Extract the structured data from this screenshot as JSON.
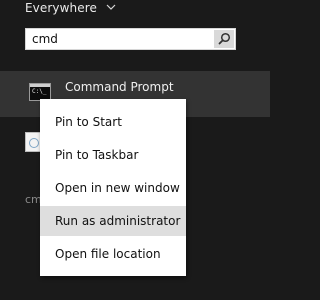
{
  "search_scope": {
    "label": "Everywhere",
    "icon": "chevron-down-icon"
  },
  "search": {
    "value": "cmd",
    "button_icon": "search-icon"
  },
  "results": [
    {
      "title": "Command Prompt",
      "icon": "command-prompt-icon",
      "selected": true
    },
    {
      "icon": "app-icon"
    }
  ],
  "faded_text": "cm",
  "context_menu": {
    "items": [
      {
        "label": "Pin to Start"
      },
      {
        "label": "Pin to Taskbar"
      },
      {
        "label": "Open in new window"
      },
      {
        "label": "Run as administrator",
        "highlighted": true
      },
      {
        "label": "Open file location"
      }
    ]
  },
  "colors": {
    "background": "#1a1a1a",
    "selected_row": "#333333",
    "menu_background": "#ffffff",
    "menu_highlight": "#dedede",
    "text_light": "#f0f0f0",
    "text_dark": "#111111"
  }
}
